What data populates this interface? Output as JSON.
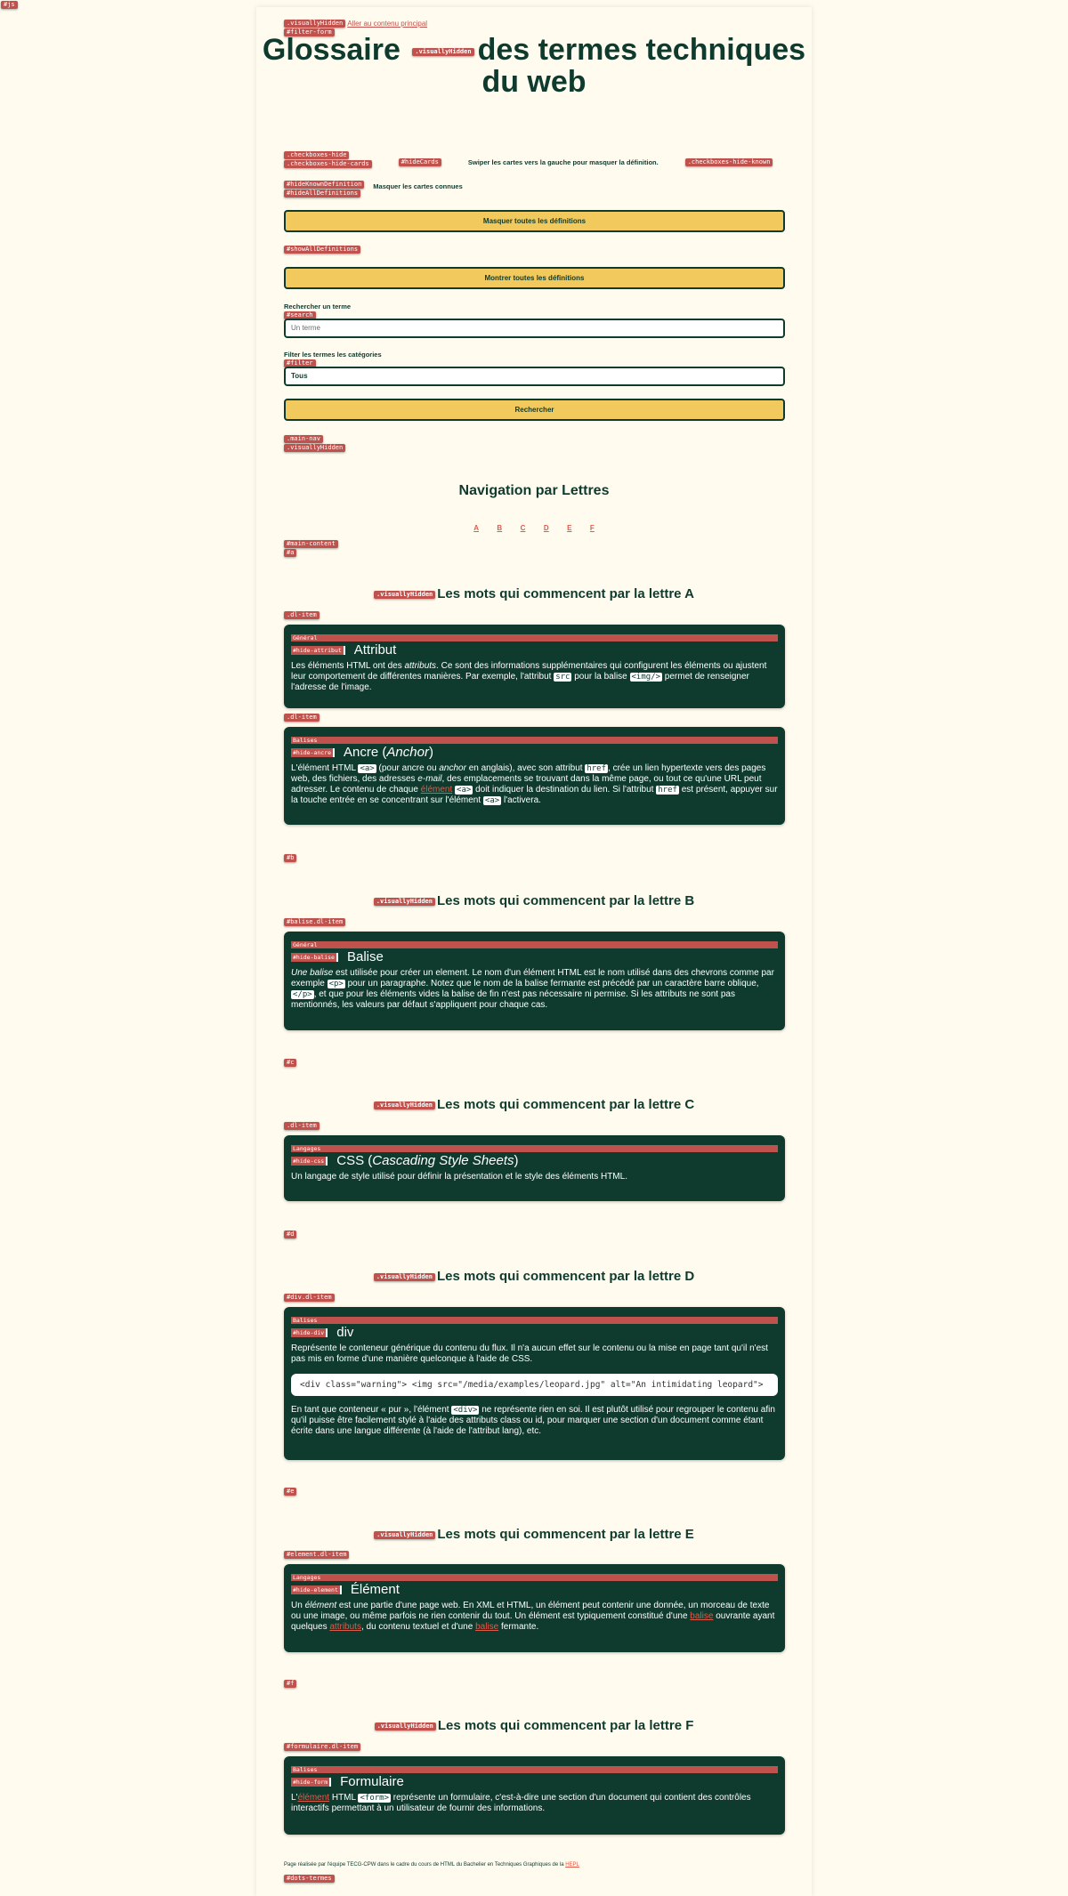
{
  "corner_tag": "#js",
  "skip": {
    "tags": [
      ".visuallyHidden",
      "#filter-form"
    ],
    "link": "Aller au contenu principal"
  },
  "title": {
    "part1": "Glossaire",
    "hidden_tag": ".visuallyHidden",
    "part2": "des termes techniques du web"
  },
  "options": {
    "checkbox_tags": [
      ".checkboxes-hide",
      ".checkboxes-hide-cards"
    ],
    "hidecards_tag": "#hideCards",
    "swipe_label": "Swiper les cartes vers la gauche pour masquer la définition.",
    "hideknown_tag": ".checkboxes-hide-known",
    "known_tags": [
      "#hideKnownDefinition",
      "#hideAllDefinitions"
    ],
    "known_label": "Masquer les cartes connues"
  },
  "buttons": {
    "hide_all": "Masquer toutes les définitions",
    "show_all_tag": "#showAllDefinitions",
    "show_all": "Montrer toutes les définitions",
    "search": "Rechercher"
  },
  "search": {
    "label": "Rechercher un terme",
    "tag": "#search",
    "placeholder": "Un terme"
  },
  "filter": {
    "label": "Filter les termes les catégories",
    "tag": "#filter",
    "value": "Tous"
  },
  "nav": {
    "tags": [
      ".main-nav",
      ".visuallyHidden"
    ],
    "title": "Navigation par Lettres",
    "letters": [
      "A",
      "B",
      "C",
      "D",
      "E",
      "F"
    ]
  },
  "main_tags": [
    "#main-content",
    "#a"
  ],
  "section_prefix_tag": ".visuallyHidden",
  "sections": [
    {
      "heading": "Les mots qui commencent par la lettre A"
    },
    {
      "anchor": "#b",
      "heading": "Les mots qui commencent par la lettre B"
    },
    {
      "anchor": "#c",
      "heading": "Les mots qui commencent par la lettre C"
    },
    {
      "anchor": "#d",
      "heading": "Les mots qui commencent par la lettre D"
    },
    {
      "anchor": "#e",
      "heading": "Les mots qui commencent par la lettre E"
    },
    {
      "anchor": "#f",
      "heading": "Les mots qui commencent par la lettre F"
    }
  ],
  "cards": {
    "attribut": {
      "item_tag": ".dl-item",
      "category": "Général",
      "hide_tag": "#hide-attribut",
      "term": "Attribut",
      "t1": "Les éléments HTML ont des ",
      "em1": "attributs",
      "t2": ". Ce sont des informations supplémentaires qui configurent les éléments ou ajustent leur comportement de différentes manières. Par exemple, l'attribut ",
      "code1": "src",
      "t3": " pour la balise ",
      "code2": "<img/>",
      "t4": " permet de renseigner l'adresse de l'image."
    },
    "ancre": {
      "item_tag": ".dl-item",
      "category": "Balises",
      "hide_tag": "#hide-ancre",
      "term1": "Ancre (",
      "term_em": "Anchor",
      "term2": ")",
      "t1": "L'élément HTML ",
      "code1": "<a>",
      "t2": " (pour ancre ou ",
      "em1": "anchor",
      "t3": " en anglais), avec son attribut ",
      "code2": "href",
      "t4": ", crée un lien hypertexte vers des pages web, des fichiers, des adresses ",
      "em2": "e-mail",
      "t5": ", des emplacements se trouvant dans la même page, ou tout ce qu'une URL peut adresser. Le contenu de chaque ",
      "link1": "élément",
      "t6": " ",
      "code3": "<a>",
      "t7": " doit indiquer la destination du lien. Si l'attribut ",
      "code4": "href",
      "t8": " est présent, appuyer sur la touche entrée en se concentrant sur l'élément ",
      "code5": "<a>",
      "t9": " l'activera."
    },
    "balise": {
      "item_tag": "#balise.dl-item",
      "category": "Général",
      "hide_tag": "#hide-balise",
      "term": "Balise",
      "em1": "Une balise",
      "t1": " est utilisée pour créer un element. Le nom d'un élément HTML est le nom utilisé dans des chevrons comme par exemple ",
      "code1": "<p>",
      "t2": " pour un paragraphe. Notez que le nom de la balise fermante est précédé par un caractère barre oblique, ",
      "code2": "</p>",
      "t3": ", et que pour les éléments vides la balise de fin n'est pas nécessaire ni permise. Si les attributs ne sont pas mentionnés, les valeurs par défaut s'appliquent pour chaque cas."
    },
    "css": {
      "item_tag": ".dl-item",
      "category": "Langages",
      "hide_tag": "#hide-css",
      "term1": "CSS (",
      "term_em": "Cascading Style Sheets",
      "term2": ")",
      "text": "Un langage de style utilisé pour définir la présentation et le style des éléments HTML."
    },
    "div": {
      "item_tag": "#div.dl-item",
      "category": "Balises",
      "hide_tag": "#hide-div",
      "term": "div",
      "p1": "Représente le conteneur générique du contenu du flux. Il n'a aucun effet sur le contenu ou la mise en page tant qu'il n'est pas mis en forme d'une manière quelconque à l'aide de CSS.",
      "code_block": "<div class=\"warning\"> <img src=\"/media/examples/leopard.jpg\" alt=\"An intimidating leopard\">",
      "t1": "En tant que conteneur « pur », l'élément ",
      "code1": "<div>",
      "t2": " ne représente rien en soi. Il est plutôt utilisé pour regrouper le contenu afin qu'il puisse être facilement stylé à l'aide des attributs class ou id, pour marquer une section d'un document comme étant écrite dans une langue différente (à l'aide de l'attribut lang), etc."
    },
    "element": {
      "item_tag": "#element.dl-item",
      "category": "Langages",
      "hide_tag": "#hide-element",
      "term": "Élément",
      "t1": "Un ",
      "em1": "élément",
      "t2": " est une partie d'une page web. En XML et HTML, un élément peut contenir une donnée, un morceau de texte ou une image, ou même parfois ne rien contenir du tout. Un élément est typiquement constitué d'une ",
      "link1": "balise",
      "t3": " ouvrante ayant quelques ",
      "link2": "attributs",
      "t4": ", du contenu textuel et d'une ",
      "link3": "balise",
      "t5": " fermante."
    },
    "formulaire": {
      "item_tag": "#formulaire.dl-item",
      "category": "Balises",
      "hide_tag": "#hide-form",
      "term": "Formulaire",
      "t1": "L'",
      "link1": "élément",
      "t2": " HTML ",
      "code1": "<form>",
      "t3": " représente un formulaire, c'est-à-dire une section d'un document qui contient des contrôles interactifs permettant à un utilisateur de fournir des informations."
    }
  },
  "footer": {
    "text": "Page réalisée par l'équipe TECG-CPW dans le cadre du cours de HTML du Bachelier en Techniques Graphiques de la ",
    "link": "HEPL",
    "end_tag": "#dots-termes"
  },
  "colors": {
    "brand": "#0e3b2e",
    "accent": "#f2c95c",
    "tag": "#c0524d",
    "link": "#e05a4a",
    "bg": "#fffbef"
  }
}
